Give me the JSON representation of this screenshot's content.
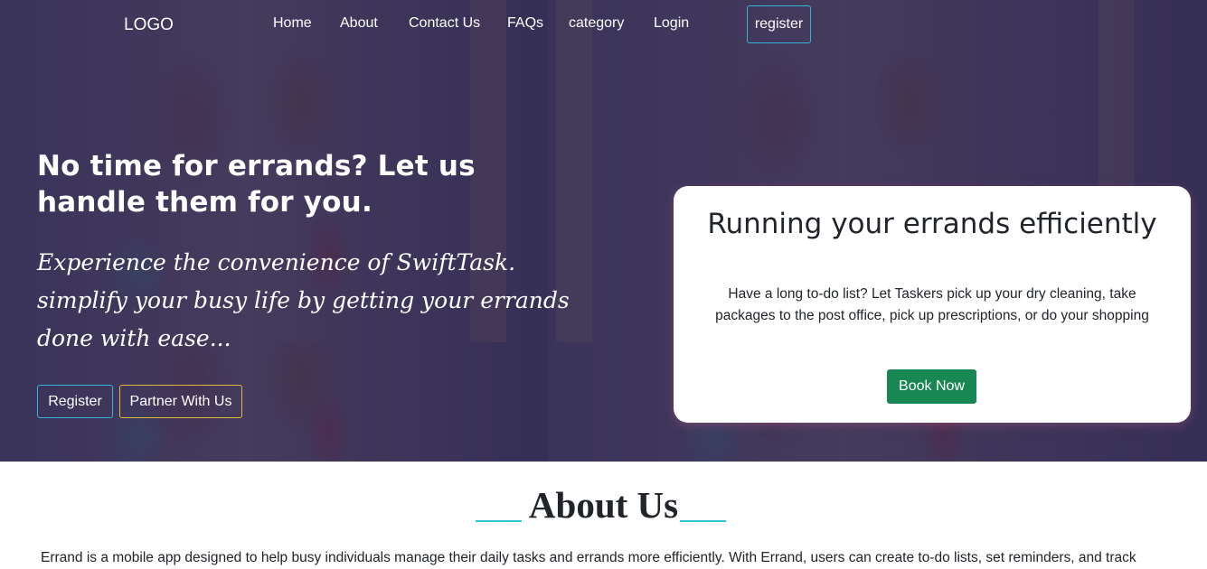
{
  "nav": {
    "logo": "LOGO",
    "links": [
      "Home",
      "About",
      "Contact Us",
      "FAQs",
      "category",
      "Login"
    ],
    "register": "register"
  },
  "hero": {
    "headline": "No time for errands? Let us handle them for you.",
    "subline": "Experience the convenience of SwiftTask. simplify your busy life by getting your errands done with ease...",
    "register_button": "Register",
    "partner_button": "Partner With Us"
  },
  "card": {
    "title": "Running your errands efficiently",
    "text": "Have a long to-do list? Let Taskers pick up your dry cleaning, take packages to the post office, pick up prescriptions, or do your shopping",
    "button": "Book Now"
  },
  "about": {
    "title": "About Us",
    "text": "Errand is a mobile app designed to help busy individuals manage their daily tasks and errands more efficiently. With Errand, users can create to-do lists, set reminders, and track"
  },
  "colors": {
    "accent_cyan": "#33b5d6",
    "accent_gold": "#e0b83c",
    "book_green": "#198754",
    "underline_teal": "#2ec4c9"
  }
}
